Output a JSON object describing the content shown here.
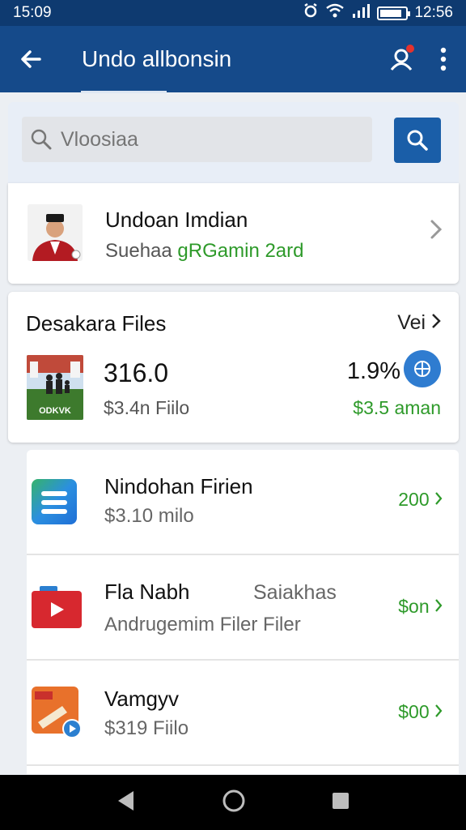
{
  "status_bar": {
    "time_left": "15:09",
    "time_right": "12:56",
    "battery_level": 0.85
  },
  "app_bar": {
    "title": "Undo allbonsin"
  },
  "search": {
    "placeholder": "Vloosiaa"
  },
  "profile": {
    "name": "Undoan Imdian",
    "subtitle_prefix": "Suehaa",
    "subtitle_highlight": "gRGamin 2ard"
  },
  "files_card": {
    "title": "Desakara Files",
    "link_label": "Vei",
    "thumb_label": "ODKVK",
    "main_value": "316.0",
    "sub_value": "$3.4n Fiilo",
    "percent": "1.9%",
    "amount": "$3.5 aman"
  },
  "list_items": [
    {
      "title": "Nindohan Firien",
      "extra": "",
      "subtitle": "$3.10 milo",
      "value": "200"
    },
    {
      "title": "Fla Nabh",
      "extra": "Saiakhas",
      "subtitle": "Andrugemim Filer Filer",
      "value": "$on"
    },
    {
      "title": "Vamgyv",
      "extra": "",
      "subtitle": "$319 Fiilo",
      "value": "$00"
    }
  ],
  "colors": {
    "header": "#154a8a",
    "status": "#0e3a70",
    "accent": "#2e9a2a",
    "button": "#1a5ea8"
  },
  "icons": {
    "back": "arrow-left-icon",
    "profile": "user-search-icon",
    "more": "more-vert-icon",
    "search": "search-icon",
    "chevron": "chevron-right-icon"
  }
}
